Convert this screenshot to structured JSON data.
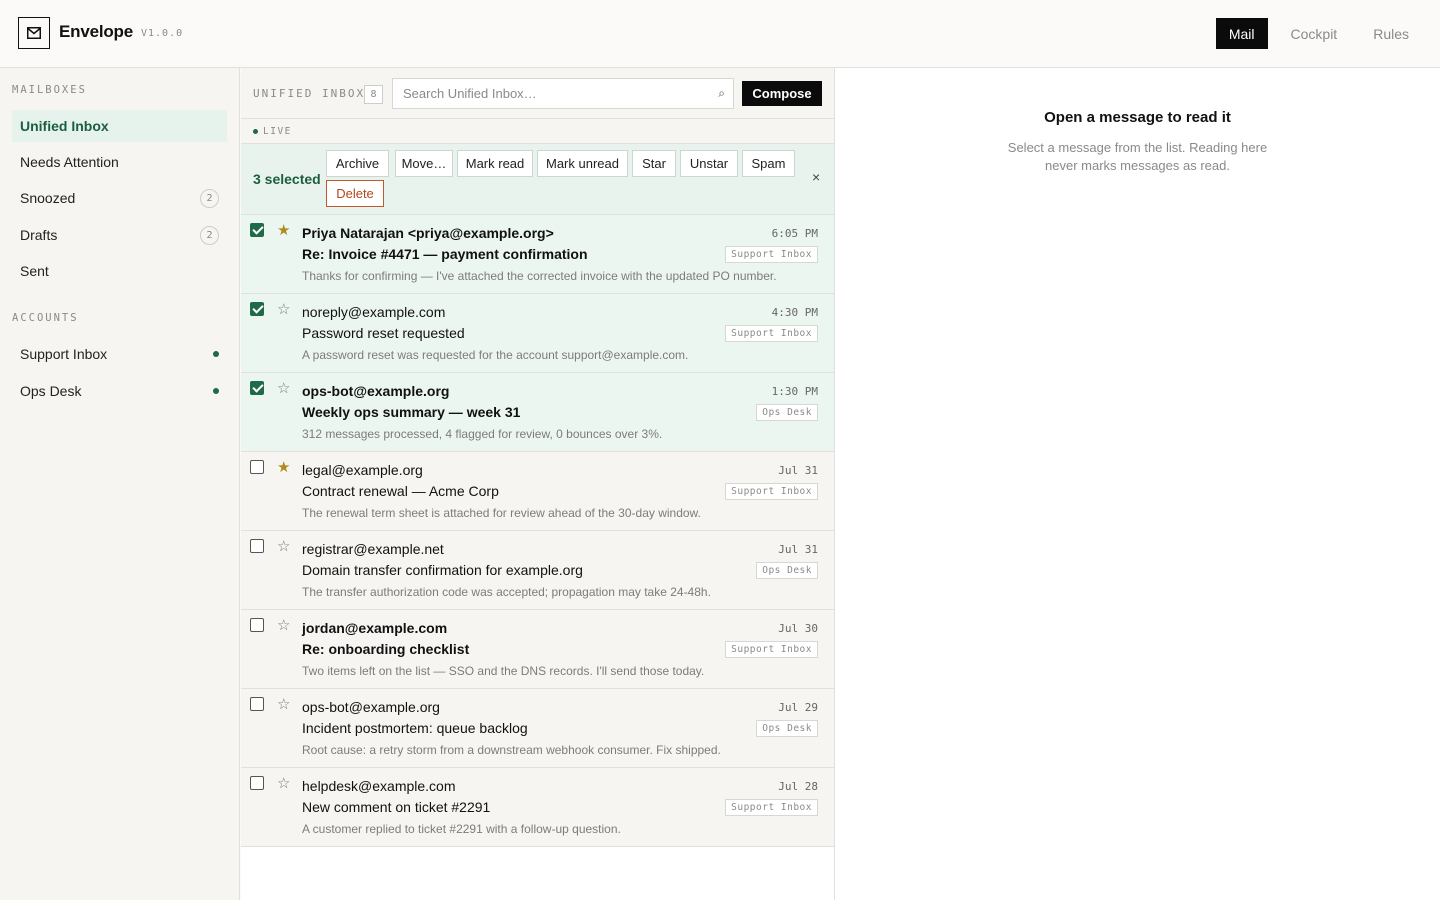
{
  "app": {
    "name": "Envelope",
    "version": "V1.0.0"
  },
  "nav": [
    "Mail",
    "Cockpit",
    "Rules"
  ],
  "sidebar": {
    "mailboxes_heading": "MAILBOXES",
    "mailboxes": [
      {
        "label": "Unified Inbox",
        "count": ""
      },
      {
        "label": "Needs Attention",
        "count": ""
      },
      {
        "label": "Snoozed",
        "count": "2"
      },
      {
        "label": "Drafts",
        "count": "2"
      },
      {
        "label": "Sent",
        "count": ""
      }
    ],
    "accounts_heading": "ACCOUNTS",
    "accounts": [
      {
        "label": "Support Inbox",
        "status_color": "#1c6b45"
      },
      {
        "label": "Ops Desk",
        "status_color": "#1c6b45"
      }
    ]
  },
  "list": {
    "title": "UNIFIED INBOX",
    "count": "8",
    "search_placeholder": "Search Unified Inbox…",
    "compose_label": "Compose",
    "live_label": "LIVE"
  },
  "bulk": {
    "selected_text": "3 selected",
    "actions": [
      "Archive",
      "Move…",
      "Mark read",
      "Mark unread",
      "Star",
      "Unstar",
      "Spam",
      "Delete"
    ],
    "close": "×"
  },
  "messages": [
    {
      "sender": "Priya Natarajan <priya@example.org>",
      "subject": "Re: Invoice #4471 — payment confirmation",
      "snippet": "Thanks for confirming — I've attached the corrected invoice with the updated PO number.",
      "time": "6:05 PM",
      "account": "Support Inbox",
      "checked": true,
      "starred": true,
      "unread": true
    },
    {
      "sender": "noreply@example.com",
      "subject": "Password reset requested",
      "snippet": "A password reset was requested for the account support@example.com.",
      "time": "4:30 PM",
      "account": "Support Inbox",
      "checked": true,
      "starred": false,
      "unread": false
    },
    {
      "sender": "ops-bot@example.org",
      "subject": "Weekly ops summary — week 31",
      "snippet": "312 messages processed, 4 flagged for review, 0 bounces over 3%.",
      "time": "1:30 PM",
      "account": "Ops Desk",
      "checked": true,
      "starred": false,
      "unread": true
    },
    {
      "sender": "legal@example.org",
      "subject": "Contract renewal — Acme Corp",
      "snippet": "The renewal term sheet is attached for review ahead of the 30-day window.",
      "time": "Jul 31",
      "account": "Support Inbox",
      "checked": false,
      "starred": true,
      "unread": false
    },
    {
      "sender": "registrar@example.net",
      "subject": "Domain transfer confirmation for example.org",
      "snippet": "The transfer authorization code was accepted; propagation may take 24-48h.",
      "time": "Jul 31",
      "account": "Ops Desk",
      "checked": false,
      "starred": false,
      "unread": false
    },
    {
      "sender": "jordan@example.com",
      "subject": "Re: onboarding checklist",
      "snippet": "Two items left on the list — SSO and the DNS records. I'll send those today.",
      "time": "Jul 30",
      "account": "Support Inbox",
      "checked": false,
      "starred": false,
      "unread": true
    },
    {
      "sender": "ops-bot@example.org",
      "subject": "Incident postmortem: queue backlog",
      "snippet": "Root cause: a retry storm from a downstream webhook consumer. Fix shipped.",
      "time": "Jul 29",
      "account": "Ops Desk",
      "checked": false,
      "starred": false,
      "unread": false
    },
    {
      "sender": "helpdesk@example.com",
      "subject": "New comment on ticket #2291",
      "snippet": "A customer replied to ticket #2291 with a follow-up question.",
      "time": "Jul 28",
      "account": "Support Inbox",
      "checked": false,
      "starred": false,
      "unread": false
    }
  ],
  "reader": {
    "title": "Open a message to read it",
    "subtitle": "Select a message from the list. Reading here never marks messages as read."
  }
}
